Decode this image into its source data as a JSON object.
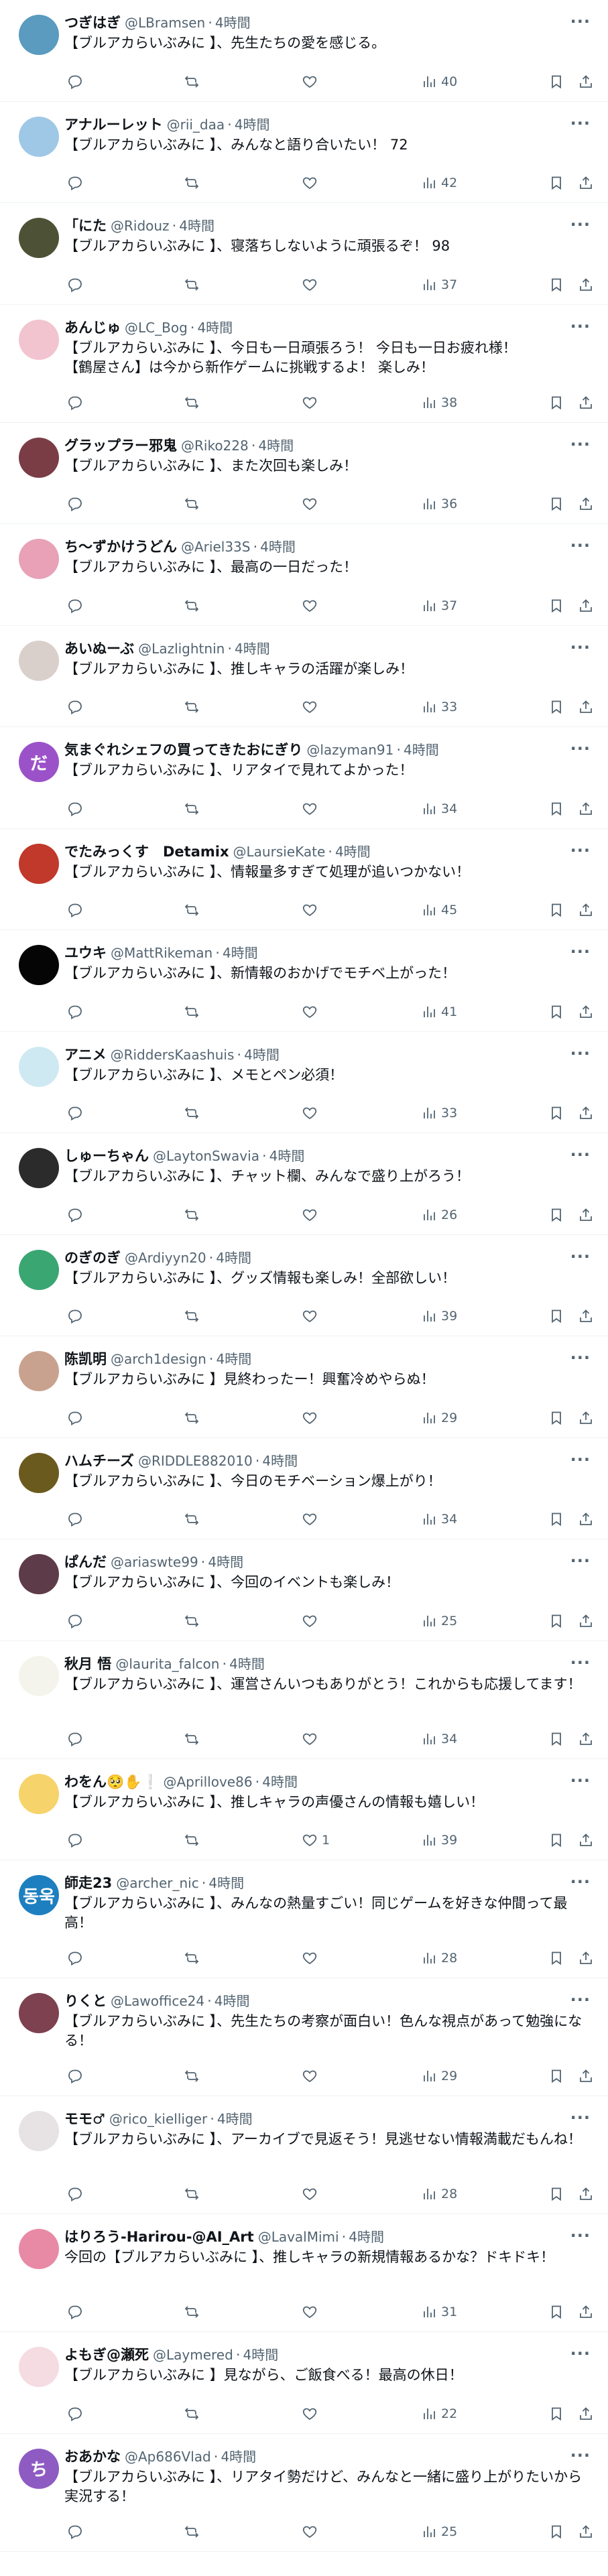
{
  "tweets": [
    {
      "name": "つぎはぎ",
      "handle": "@LBramsen",
      "time": "4時間",
      "text": "【ブルアカらいぶみに 】、先生たちの愛を感じる。",
      "likes": "",
      "views": "40",
      "avatar_color": "#5a9bbf",
      "avatar_text": ""
    },
    {
      "name": "アナルーレット",
      "handle": "@rii_daa",
      "time": "4時間",
      "text": "【ブルアカらいぶみに 】、みんなと語り合いたい！ 72",
      "likes": "",
      "views": "42",
      "avatar_color": "#9ec8e6",
      "avatar_text": ""
    },
    {
      "name": "「にた",
      "handle": "@Ridouz",
      "time": "4時間",
      "text": "【ブルアカらいぶみに 】、寝落ちしないように頑張るぞ！ 98",
      "likes": "",
      "views": "37",
      "avatar_color": "#4d5236",
      "avatar_text": ""
    },
    {
      "name": "あんじゅ",
      "handle": "@LC_Bog",
      "time": "4時間",
      "text": "【ブルアカらいぶみに 】、今日も一日頑張ろう！ 今日も一日お疲れ様！\n【鶴屋さん】は今から新作ゲームに挑戦するよ！ 楽しみ！",
      "likes": "",
      "views": "38",
      "avatar_color": "#f2c4cf",
      "avatar_text": ""
    },
    {
      "name": "グラップラー邪鬼",
      "handle": "@Riko228",
      "time": "4時間",
      "text": "【ブルアカらいぶみに 】、また次回も楽しみ！",
      "likes": "",
      "views": "36",
      "avatar_color": "#7a3d46",
      "avatar_text": ""
    },
    {
      "name": "ち～ずかけうどん",
      "handle": "@Ariel33S",
      "time": "4時間",
      "text": "【ブルアカらいぶみに 】、最高の一日だった！",
      "likes": "",
      "views": "37",
      "avatar_color": "#e8a1b7",
      "avatar_text": ""
    },
    {
      "name": "あいぬーぶ",
      "handle": "@Lazlightnin",
      "time": "4時間",
      "text": "【ブルアカらいぶみに 】、推しキャラの活躍が楽しみ！",
      "likes": "",
      "views": "33",
      "avatar_color": "#d9cfcb",
      "avatar_text": ""
    },
    {
      "name": "気まぐれシェフの買ってきたおにぎり",
      "handle": "@lazyman91",
      "time": "4時間",
      "text": "【ブルアカらいぶみに 】、リアタイで見れてよかった！",
      "likes": "",
      "views": "34",
      "avatar_color": "#9b52c9",
      "avatar_text": "だ"
    },
    {
      "name": "でたみっくす　Detamix",
      "handle": "@LaursieKate",
      "time": "4時間",
      "text": "【ブルアカらいぶみに 】、情報量多すぎて処理が追いつかない！",
      "likes": "",
      "views": "45",
      "avatar_color": "#c0392b",
      "avatar_text": ""
    },
    {
      "name": "ユウキ",
      "handle": "@MattRikeman",
      "time": "4時間",
      "text": "【ブルアカらいぶみに 】、新情報のおかげでモチベ上がった！",
      "likes": "",
      "views": "41",
      "avatar_color": "#050505",
      "avatar_text": ""
    },
    {
      "name": "アニメ",
      "handle": "@RiddersKaashuis",
      "time": "4時間",
      "text": "【ブルアカらいぶみに 】、メモとペン必須！",
      "likes": "",
      "views": "33",
      "avatar_color": "#cfe9f2",
      "avatar_text": ""
    },
    {
      "name": "しゅーちゃん",
      "handle": "@LaytonSwavia",
      "time": "4時間",
      "text": "【ブルアカらいぶみに 】、チャット欄、みんなで盛り上がろう！",
      "likes": "",
      "views": "26",
      "avatar_color": "#2b2b2b",
      "avatar_text": ""
    },
    {
      "name": "のぎのぎ",
      "handle": "@Ardiyyn20",
      "time": "4時間",
      "text": "【ブルアカらいぶみに 】、グッズ情報も楽しみ！全部欲しい！",
      "likes": "",
      "views": "39",
      "avatar_color": "#3aa672",
      "avatar_text": ""
    },
    {
      "name": "陈凯明",
      "handle": "@arch1design",
      "time": "4時間",
      "text": "【ブルアカらいぶみに 】見終わったー！興奮冷めやらぬ！",
      "likes": "",
      "views": "29",
      "avatar_color": "#c9a28f",
      "avatar_text": ""
    },
    {
      "name": "ハムチーズ",
      "handle": "@RIDDLE882010",
      "time": "4時間",
      "text": "【ブルアカらいぶみに 】、今日のモチベーション爆上がり！",
      "likes": "",
      "views": "34",
      "avatar_color": "#6b5a1e",
      "avatar_text": ""
    },
    {
      "name": "ぱんだ",
      "handle": "@ariaswte99",
      "time": "4時間",
      "text": "【ブルアカらいぶみに 】、今回のイベントも楽しみ！",
      "likes": "",
      "views": "25",
      "avatar_color": "#5e3b48",
      "avatar_text": ""
    },
    {
      "name": "秋月 悟",
      "handle": "@laurita_falcon",
      "time": "4時間",
      "text": "【ブルアカらいぶみに 】、運営さんいつもありがとう！これからも応援してます！",
      "likes": "",
      "views": "34",
      "avatar_color": "#f4f4ec",
      "avatar_text": ""
    },
    {
      "name": "わをん🥺✋❕",
      "handle": "@Aprillove86",
      "time": "4時間",
      "text": "【ブルアカらいぶみに 】、推しキャラの声優さんの情報も嬉しい！",
      "likes": "1",
      "views": "39",
      "avatar_color": "#f6d36b",
      "avatar_text": ""
    },
    {
      "name": "師走23",
      "handle": "@archer_nic",
      "time": "4時間",
      "text": "【ブルアカらいぶみに 】、みんなの熱量すごい！同じゲームを好きな仲間って最高！",
      "likes": "",
      "views": "28",
      "avatar_color": "#1d7fbf",
      "avatar_text": "동욱"
    },
    {
      "name": "りくと",
      "handle": "@Lawoffice24",
      "time": "4時間",
      "text": "【ブルアカらいぶみに 】、先生たちの考察が面白い！色んな視点があって勉強になる！",
      "likes": "",
      "views": "29",
      "avatar_color": "#7d4150",
      "avatar_text": ""
    },
    {
      "name": "モモ♂",
      "handle": "@rico_kielliger",
      "time": "4時間",
      "text": "【ブルアカらいぶみに 】、アーカイブで見返そう！見逃せない情報満載だもんね！",
      "likes": "",
      "views": "28",
      "avatar_color": "#e7e2e4",
      "avatar_text": ""
    },
    {
      "name": "はりろう-Harirou-@AI_Art",
      "handle": "@LavalMimi",
      "time": "4時間",
      "text": "今回の【ブルアカらいぶみに 】、推しキャラの新規情報あるかな？ドキドキ！",
      "likes": "",
      "views": "31",
      "avatar_color": "#e88aa6",
      "avatar_text": ""
    },
    {
      "name": "よもぎ@瀬死",
      "handle": "@Laymered",
      "time": "4時間",
      "text": "【ブルアカらいぶみに 】見ながら、ご飯食べる！最高の休日！",
      "likes": "",
      "views": "22",
      "avatar_color": "#f5dbe2",
      "avatar_text": ""
    },
    {
      "name": "おあかな",
      "handle": "@Ap686Vlad",
      "time": "4時間",
      "text": "【ブルアカらいぶみに 】、リアタイ勢だけど、みんなと一緒に盛り上がりたいから実況する！",
      "likes": "",
      "views": "25",
      "avatar_color": "#8e5bc3",
      "avatar_text": "ち"
    }
  ]
}
